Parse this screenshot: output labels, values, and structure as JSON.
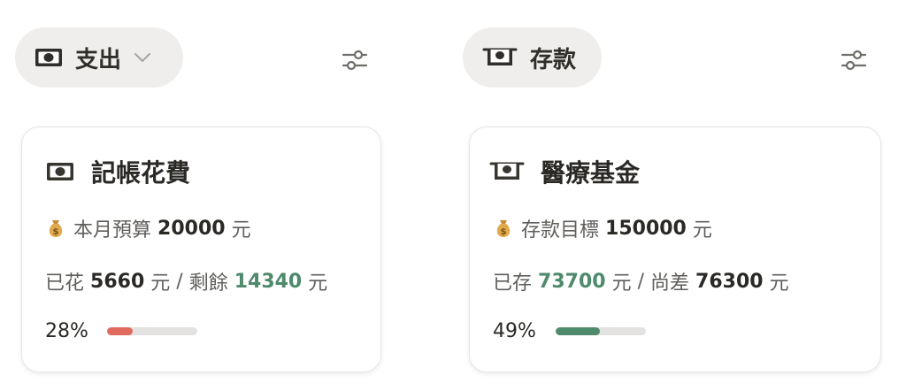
{
  "left": {
    "pill_label": "支出",
    "card": {
      "title": "記帳花費",
      "budget_label": "本月預算",
      "budget_value": "20000",
      "unit": "元",
      "spent_label": "已花",
      "spent_value": "5660",
      "separator": "/",
      "remaining_label": "剩餘",
      "remaining_value": "14340",
      "progress_text": "28%",
      "progress": 0.28,
      "progress_color": "#e16a5f"
    }
  },
  "right": {
    "pill_label": "存款",
    "card": {
      "title": "醫療基金",
      "target_label": "存款目標",
      "target_value": "150000",
      "unit": "元",
      "saved_label": "已存",
      "saved_value": "73700",
      "separator": "/",
      "shortfall_label": "尚差",
      "shortfall_value": "76300",
      "progress_text": "49%",
      "progress": 0.49,
      "progress_color": "#4e8a6b"
    }
  },
  "icons": {
    "left_pill": "money-bill-icon",
    "left_dropdown": "chevron-down-icon",
    "filter": "sliders-icon",
    "right_pill": "money-withdraw-icon",
    "bag": "money-bag-icon"
  }
}
